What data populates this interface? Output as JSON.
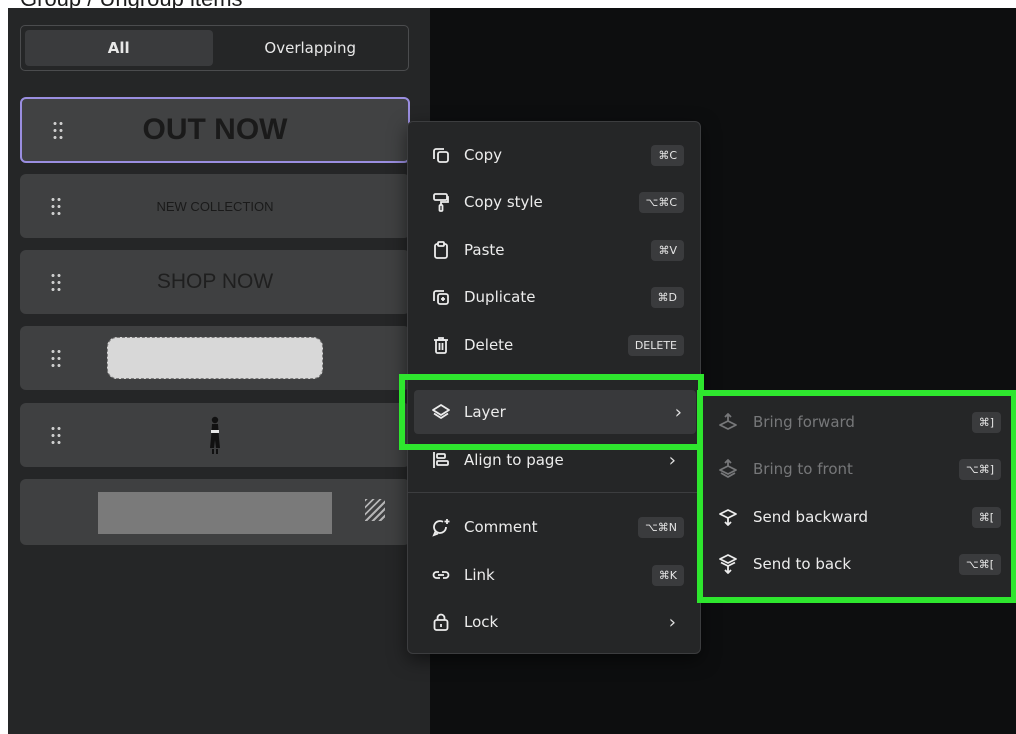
{
  "header": {
    "title_fragment": "Group / Ungroup items"
  },
  "filter_tabs": [
    {
      "label": "All",
      "active": true
    },
    {
      "label": "Overlapping",
      "active": false
    }
  ],
  "layers": [
    {
      "preview_text": "OUT NOW",
      "selected": true
    },
    {
      "preview_text": "NEW COLLECTION"
    },
    {
      "preview_text": "SHOP NOW"
    },
    {
      "preview_kind": "dashed-pill"
    },
    {
      "preview_kind": "person-photo"
    },
    {
      "preview_kind": "gray-rectangle"
    }
  ],
  "context_menu": {
    "items": [
      {
        "label": "Copy",
        "shortcut": "⌘C",
        "icon": "copy-icon"
      },
      {
        "label": "Copy style",
        "shortcut": "⌥⌘C",
        "icon": "paint-roller-icon"
      },
      {
        "label": "Paste",
        "shortcut": "⌘V",
        "icon": "clipboard-icon"
      },
      {
        "label": "Duplicate",
        "shortcut": "⌘D",
        "icon": "duplicate-icon"
      },
      {
        "label": "Delete",
        "shortcut": "DELETE",
        "icon": "trash-icon"
      },
      {
        "label": "Layer",
        "submenu": true,
        "icon": "layers-icon",
        "highlighted": true
      },
      {
        "label": "Align to page",
        "submenu": true,
        "icon": "align-icon"
      },
      {
        "label": "Comment",
        "shortcut": "⌥⌘N",
        "icon": "comment-icon"
      },
      {
        "label": "Link",
        "shortcut": "⌘K",
        "icon": "link-icon"
      },
      {
        "label": "Lock",
        "submenu": true,
        "icon": "lock-icon"
      }
    ]
  },
  "layer_submenu": {
    "items": [
      {
        "label": "Bring forward",
        "shortcut": "⌘]",
        "enabled": false,
        "icon": "bring-forward-icon"
      },
      {
        "label": "Bring to front",
        "shortcut": "⌥⌘]",
        "enabled": false,
        "icon": "bring-to-front-icon"
      },
      {
        "label": "Send backward",
        "shortcut": "⌘[",
        "enabled": true,
        "icon": "send-backward-icon"
      },
      {
        "label": "Send to back",
        "shortcut": "⌥⌘[",
        "enabled": true,
        "icon": "send-to-back-icon"
      }
    ]
  },
  "colors": {
    "panel_bg": "#252627",
    "canvas_bg": "#0d0e0f",
    "selection_border": "#9a8ee0",
    "highlight_green": "#2ee62e"
  }
}
